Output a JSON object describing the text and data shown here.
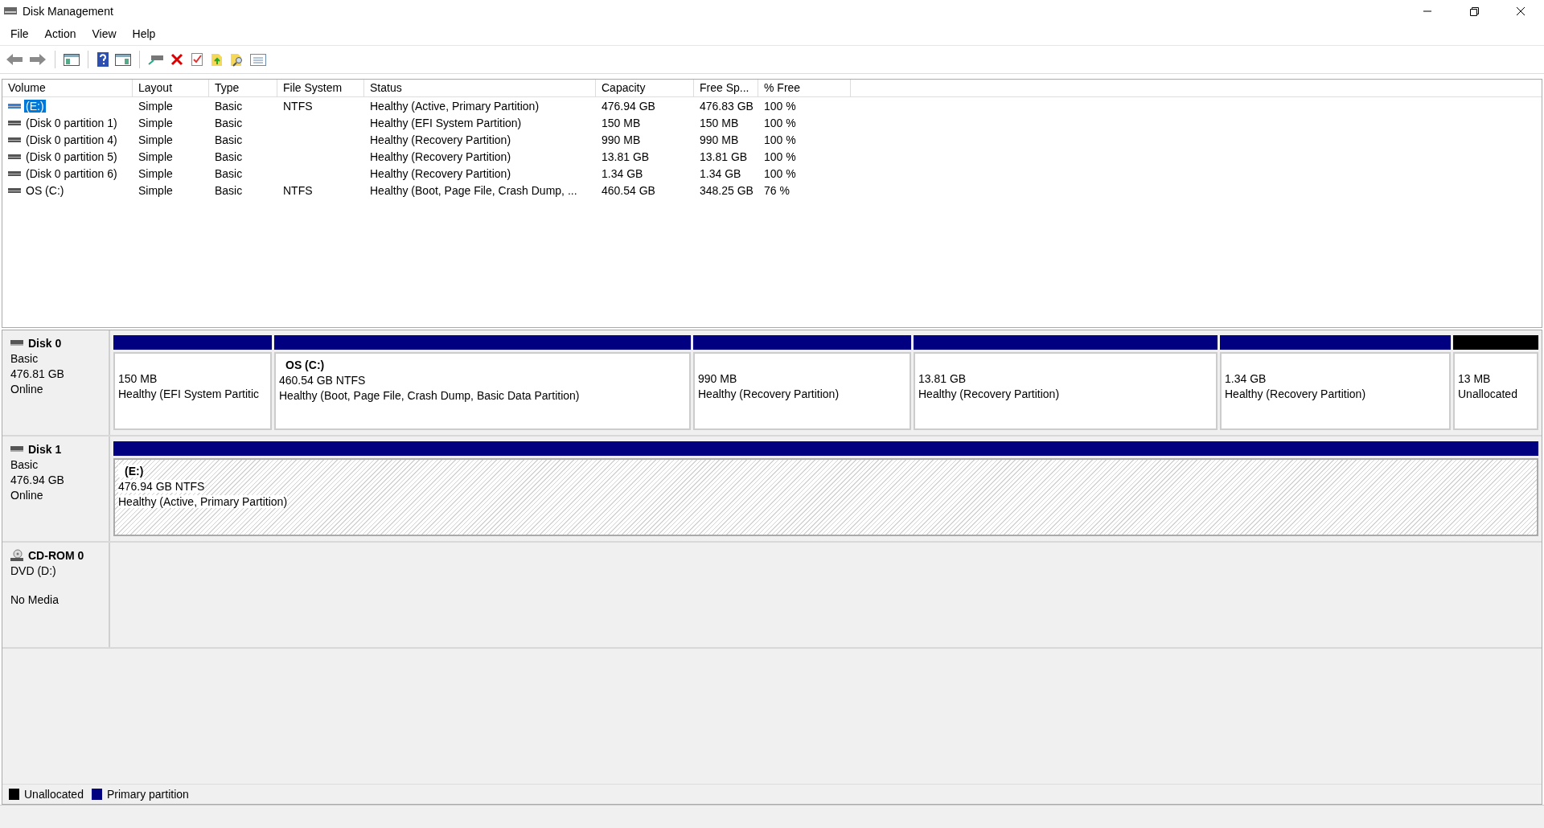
{
  "window": {
    "title": "Disk Management"
  },
  "menu": [
    "File",
    "Action",
    "View",
    "Help"
  ],
  "table": {
    "columns": [
      "Volume",
      "Layout",
      "Type",
      "File System",
      "Status",
      "Capacity",
      "Free Sp...",
      "% Free"
    ],
    "rows": [
      {
        "selected": true,
        "cells": [
          "(E:)",
          "Simple",
          "Basic",
          "NTFS",
          "Healthy (Active, Primary Partition)",
          "476.94 GB",
          "476.83 GB",
          "100 %"
        ]
      },
      {
        "selected": false,
        "cells": [
          "(Disk 0 partition 1)",
          "Simple",
          "Basic",
          "",
          "Healthy (EFI System Partition)",
          "150 MB",
          "150 MB",
          "100 %"
        ]
      },
      {
        "selected": false,
        "cells": [
          "(Disk 0 partition 4)",
          "Simple",
          "Basic",
          "",
          "Healthy (Recovery Partition)",
          "990 MB",
          "990 MB",
          "100 %"
        ]
      },
      {
        "selected": false,
        "cells": [
          "(Disk 0 partition 5)",
          "Simple",
          "Basic",
          "",
          "Healthy (Recovery Partition)",
          "13.81 GB",
          "13.81 GB",
          "100 %"
        ]
      },
      {
        "selected": false,
        "cells": [
          "(Disk 0 partition 6)",
          "Simple",
          "Basic",
          "",
          "Healthy (Recovery Partition)",
          "1.34 GB",
          "1.34 GB",
          "100 %"
        ]
      },
      {
        "selected": false,
        "cells": [
          "OS (C:)",
          "Simple",
          "Basic",
          "NTFS",
          "Healthy (Boot, Page File, Crash Dump, ...",
          "460.54 GB",
          "348.25 GB",
          "76 %"
        ]
      }
    ]
  },
  "disks": [
    {
      "kind": "disk",
      "name": "Disk 0",
      "lines": [
        "Basic",
        "476.81 GB"
      ],
      "status": "Online",
      "partitions": [
        {
          "selected": false,
          "color": "#000080",
          "size": "150 MB",
          "status": "Healthy (EFI System Partitic"
        },
        {
          "selected": false,
          "color": "#000080",
          "name": "OS  (C:)",
          "size": "460.54 GB NTFS",
          "status": "Healthy (Boot, Page File, Crash Dump, Basic Data Partition)"
        },
        {
          "selected": false,
          "color": "#000080",
          "size": "990 MB",
          "status": "Healthy (Recovery Partition)"
        },
        {
          "selected": false,
          "color": "#000080",
          "size": "13.81 GB",
          "status": "Healthy (Recovery Partition)"
        },
        {
          "selected": false,
          "color": "#000080",
          "size": "1.34 GB",
          "status": "Healthy (Recovery Partition)"
        },
        {
          "selected": false,
          "color": "#000000",
          "size": "13 MB",
          "status": "Unallocated"
        }
      ]
    },
    {
      "kind": "disk",
      "name": "Disk 1",
      "lines": [
        "Basic",
        "476.94 GB"
      ],
      "status": "Online",
      "partitions": [
        {
          "selected": true,
          "color": "#000080",
          "name": "(E:)",
          "size": "476.94 GB NTFS",
          "status": "Healthy (Active, Primary Partition)"
        }
      ]
    },
    {
      "kind": "cdrom",
      "name": "CD-ROM 0",
      "lines": [
        "DVD (D:)"
      ],
      "status": "No Media"
    }
  ],
  "legend": [
    {
      "label": "Unallocated",
      "color": "#000000"
    },
    {
      "label": "Primary partition",
      "color": "#000080"
    }
  ]
}
